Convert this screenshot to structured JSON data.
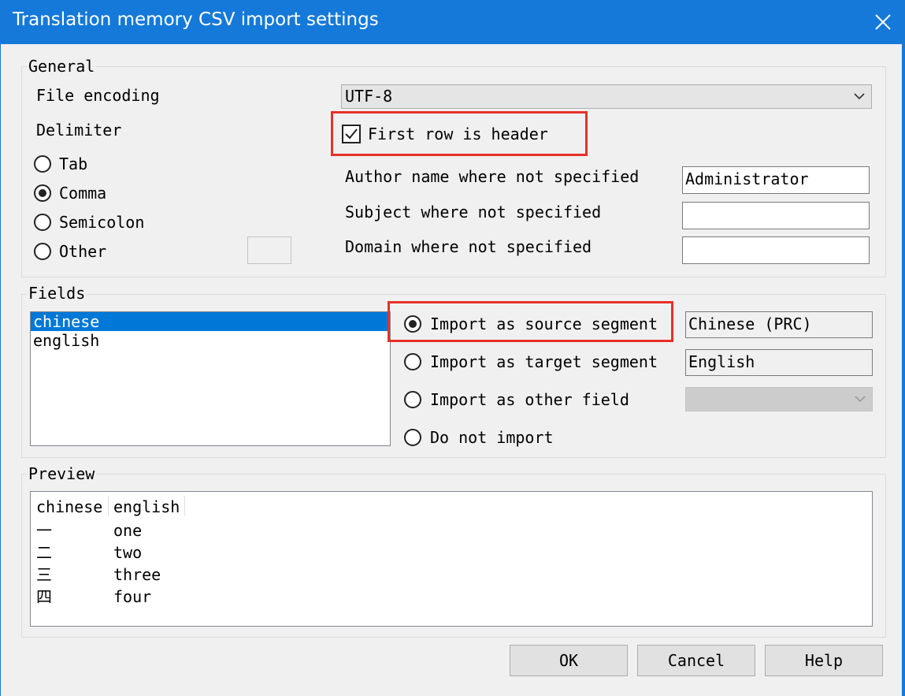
{
  "window": {
    "title": "Translation memory CSV import settings"
  },
  "general": {
    "label": "General",
    "file_encoding_label": "File encoding",
    "file_encoding_value": "UTF-8",
    "delimiter_label": "Delimiter",
    "delimiters": [
      {
        "label": "Tab",
        "checked": false
      },
      {
        "label": "Comma",
        "checked": true
      },
      {
        "label": "Semicolon",
        "checked": false
      },
      {
        "label": "Other",
        "checked": false
      }
    ],
    "other_delimiter_value": "",
    "first_row_header_label": "First row is header",
    "first_row_header_checked": true,
    "author_label": "Author name where not specified",
    "author_value": "Administrator",
    "subject_label": "Subject where not specified",
    "subject_value": "",
    "domain_label": "Domain where not specified",
    "domain_value": ""
  },
  "fields": {
    "label": "Fields",
    "items": [
      "chinese",
      "english"
    ],
    "selected_index": 0,
    "options": [
      {
        "label": "Import as source segment",
        "checked": true,
        "value": "Chinese (PRC)"
      },
      {
        "label": "Import as target segment",
        "checked": false,
        "value": "English"
      },
      {
        "label": "Import as other field",
        "checked": false,
        "value": ""
      },
      {
        "label": "Do not import",
        "checked": false
      }
    ]
  },
  "preview": {
    "label": "Preview",
    "headers": [
      "chinese",
      "english"
    ],
    "rows": [
      [
        "一",
        "one"
      ],
      [
        "二",
        "two"
      ],
      [
        "三",
        "three"
      ],
      [
        "四",
        "four"
      ]
    ]
  },
  "buttons": {
    "ok": "OK",
    "cancel": "Cancel",
    "help": "Help"
  },
  "colors": {
    "titlebar": "#1479d9",
    "highlight": "#e8302a",
    "selection": "#0078d7"
  }
}
